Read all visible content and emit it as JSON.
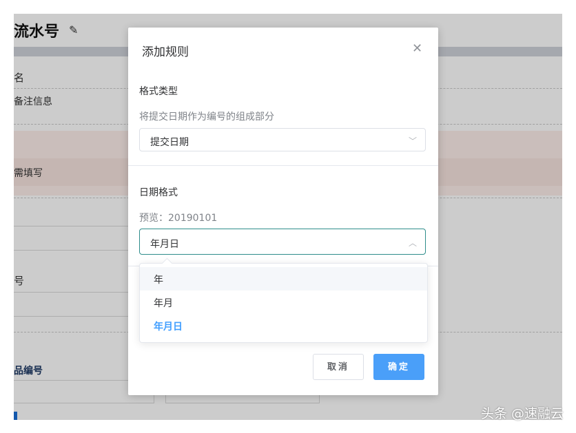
{
  "background": {
    "page_title": "流水号",
    "edit_icon": "pencil-icon",
    "field_name": "名",
    "note": "备注信息",
    "required_hint": "需填写",
    "label_hao": "号",
    "label_product_number": "品编号"
  },
  "dialog": {
    "title": "添加规则",
    "close_icon": "close-icon",
    "format_type_label": "格式类型",
    "format_type_hint": "将提交日期作为编号的组成部分",
    "format_type_value": "提交日期",
    "date_format_label": "日期格式",
    "preview_label": "预览：20190101",
    "date_format_value": "年月日",
    "options": [
      "年",
      "年月",
      "年月日"
    ],
    "selected_option_index": 2,
    "hovered_option_index": 0,
    "cancel_label": "取消",
    "ok_label": "确定"
  },
  "watermark": "头条 @速融云",
  "colors": {
    "primary": "#409eff",
    "ok_button": "#4a9ff9",
    "focus_border": "#2d8c8a"
  }
}
